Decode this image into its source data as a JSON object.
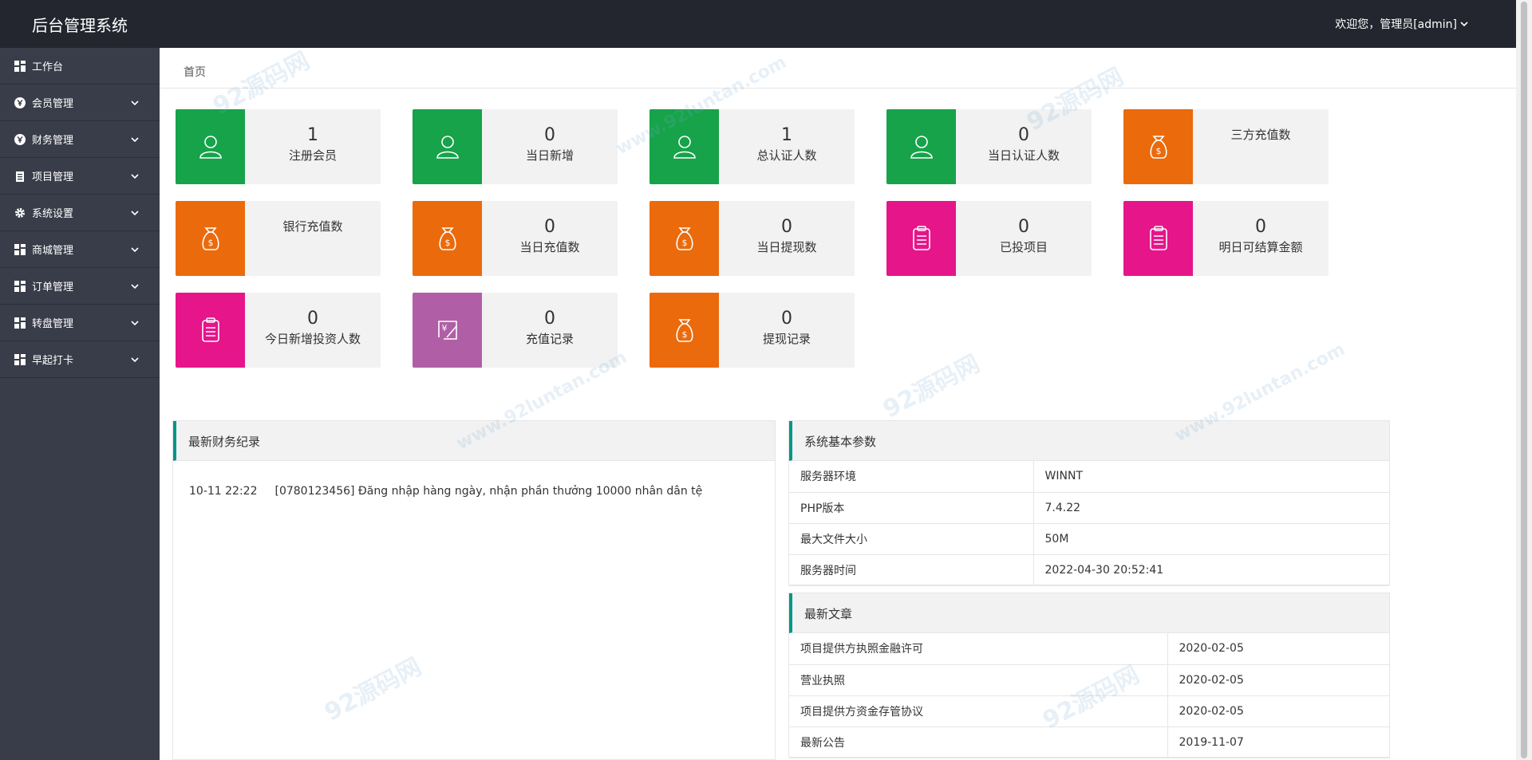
{
  "app": {
    "title": "后台管理系统",
    "welcome": "欢迎您，管理员[admin]"
  },
  "sidebar": {
    "items": [
      {
        "label": "工作台",
        "icon": "dashboard-icon",
        "expandable": false
      },
      {
        "label": "会员管理",
        "icon": "yen-circle-icon",
        "expandable": true
      },
      {
        "label": "财务管理",
        "icon": "yen-circle-icon",
        "expandable": true
      },
      {
        "label": "项目管理",
        "icon": "clipboard-icon",
        "expandable": true
      },
      {
        "label": "系统设置",
        "icon": "gear-icon",
        "expandable": true
      },
      {
        "label": "商城管理",
        "icon": "dashboard-icon",
        "expandable": true
      },
      {
        "label": "订单管理",
        "icon": "dashboard-icon",
        "expandable": true
      },
      {
        "label": "转盘管理",
        "icon": "dashboard-icon",
        "expandable": true
      },
      {
        "label": "早起打卡",
        "icon": "dashboard-icon",
        "expandable": true
      }
    ]
  },
  "breadcrumb": {
    "home": "首页"
  },
  "stats": [
    {
      "value": "1",
      "label": "注册会员",
      "color": "#16a34a",
      "icon": "user-icon"
    },
    {
      "value": "0",
      "label": "当日新增",
      "color": "#16a34a",
      "icon": "user-icon"
    },
    {
      "value": "1",
      "label": "总认证人数",
      "color": "#16a34a",
      "icon": "user-icon"
    },
    {
      "value": "0",
      "label": "当日认证人数",
      "color": "#16a34a",
      "icon": "user-icon"
    },
    {
      "value": "",
      "label": "三方充值数",
      "color": "#ea6a0c",
      "icon": "money-bag-icon"
    },
    {
      "value": "",
      "label": "银行充值数",
      "color": "#ea6a0c",
      "icon": "money-bag-icon"
    },
    {
      "value": "0",
      "label": "当日充值数",
      "color": "#ea6a0c",
      "icon": "money-bag-icon"
    },
    {
      "value": "0",
      "label": "当日提现数",
      "color": "#ea6a0c",
      "icon": "money-bag-icon"
    },
    {
      "value": "0",
      "label": "已投项目",
      "color": "#e6158a",
      "icon": "clipboard-list-icon"
    },
    {
      "value": "0",
      "label": "明日可结算金额",
      "color": "#e6158a",
      "icon": "clipboard-list-icon"
    },
    {
      "value": "0",
      "label": "今日新增投资人数",
      "color": "#e6158a",
      "icon": "clipboard-list-icon"
    },
    {
      "value": "0",
      "label": "充值记录",
      "color": "#b05fa6",
      "icon": "recharge-icon"
    },
    {
      "value": "0",
      "label": "提现记录",
      "color": "#ea6a0c",
      "icon": "money-bag-icon"
    }
  ],
  "finance": {
    "title": "最新财务纪录",
    "records": [
      {
        "time": "10-11 22:22",
        "text": "[0780123456] Đăng nhập hàng ngày, nhận phần thưởng 10000 nhân dân tệ"
      }
    ]
  },
  "system": {
    "title": "系统基本参数",
    "rows": [
      {
        "key": "服务器环境",
        "value": "WINNT"
      },
      {
        "key": "PHP版本",
        "value": "7.4.22"
      },
      {
        "key": "最大文件大小",
        "value": "50M"
      },
      {
        "key": "服务器时间",
        "value": "2022-04-30 20:52:41"
      }
    ]
  },
  "articles": {
    "title": "最新文章",
    "rows": [
      {
        "title": "项目提供方执照金融许可",
        "date": "2020-02-05"
      },
      {
        "title": "营业执照",
        "date": "2020-02-05"
      },
      {
        "title": "项目提供方资金存管协议",
        "date": "2020-02-05"
      },
      {
        "title": "最新公告",
        "date": "2019-11-07"
      }
    ]
  },
  "watermark": {
    "brand": "92源码网",
    "url": "www.92luntan.com"
  }
}
